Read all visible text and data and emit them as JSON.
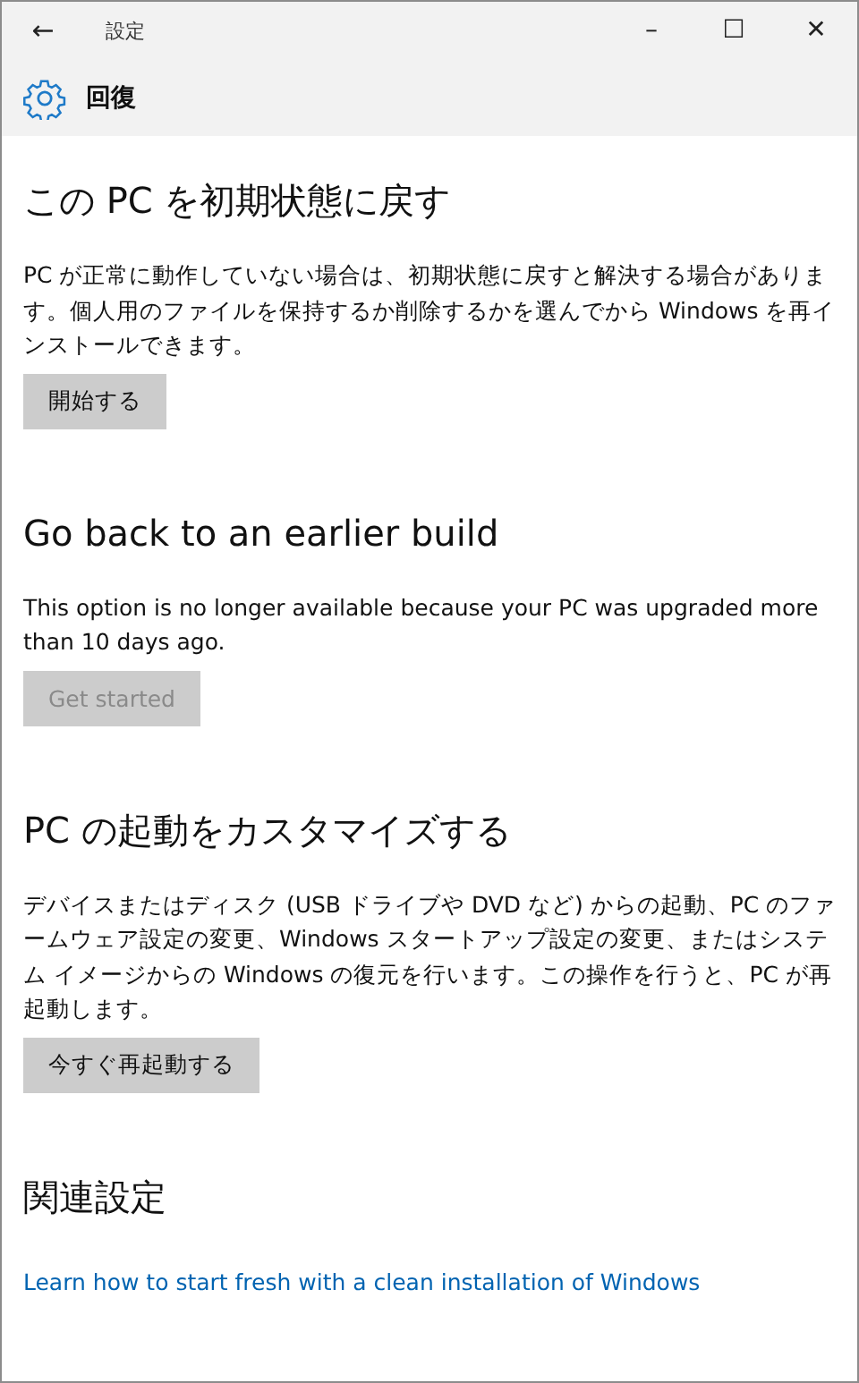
{
  "window": {
    "title": "設定",
    "back": "←",
    "controls": [
      "–",
      "☐",
      "✕"
    ]
  },
  "header": {
    "title": "回復"
  },
  "sections": [
    {
      "heading": "この PC を初期状態に戻す",
      "text": "PC が正常に動作していない場合は、初期状態に戻すと解決する場合があります。個人用のファイルを保持するか削除するかを選んでから Windows を再インストールできます。",
      "button": {
        "label": "開始する",
        "disabled": false
      }
    },
    {
      "heading": "Go back to an earlier build",
      "text": "This option is no longer available because your PC was upgraded more than 10 days ago.",
      "button": {
        "label": "Get started",
        "disabled": true
      }
    },
    {
      "heading": "PC の起動をカスタマイズする",
      "text": "デバイスまたはディスク (USB ドライブや DVD など) からの起動、PC のファームウェア設定の変更、Windows スタートアップ設定の変更、またはシステム イメージからの Windows の復元を行います。この操作を行うと、PC が再起動します。",
      "button": {
        "label": "今すぐ再起動する",
        "disabled": false
      }
    }
  ],
  "related": {
    "heading": "関連設定",
    "link": "Learn how to start fresh with a clean installation of Windows"
  }
}
